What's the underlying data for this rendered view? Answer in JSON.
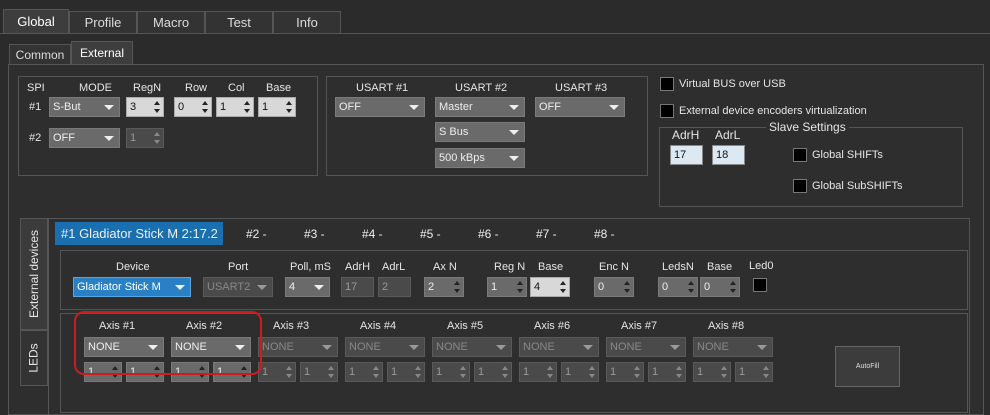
{
  "top_tabs": [
    "Global",
    "Profile",
    "Macro",
    "Test",
    "Info"
  ],
  "sub_tabs": [
    "Common",
    "External"
  ],
  "spi": {
    "headers": [
      "SPI",
      "MODE",
      "RegN",
      "Row",
      "Col",
      "Base"
    ],
    "row_labels": [
      "#1",
      "#2"
    ],
    "row1": {
      "mode": "S-But",
      "regn": "3",
      "row": "0",
      "col": "1",
      "base": "1"
    },
    "row2": {
      "mode": "OFF",
      "regn": "1"
    }
  },
  "usart": {
    "headers": [
      "USART #1",
      "USART #2",
      "USART #3"
    ],
    "u1": "OFF",
    "u2_mode": "Master",
    "u2_bus": "S Bus",
    "u2_speed": "500 kBps",
    "u3": "OFF"
  },
  "options": {
    "virtual_bus": "Virtual BUS over USB",
    "ext_encoders": "External device encoders virtualization"
  },
  "slave": {
    "title": "Slave Settings",
    "adrh_label": "AdrH",
    "adrl_label": "AdrL",
    "adrh": "17",
    "adrl": "18",
    "global_shifts": "Global SHIFTs",
    "global_subshifts": "Global SubSHIFTs"
  },
  "side_tabs": [
    "External devices",
    "LEDs"
  ],
  "device_tabs": [
    "#1 Gladiator Stick M 2:17.2",
    "#2 -",
    "#3 -",
    "#4 -",
    "#5 -",
    "#6 -",
    "#7 -",
    "#8 -"
  ],
  "device": {
    "headers": [
      "Device",
      "Port",
      "Poll, mS",
      "AdrH",
      "AdrL",
      "Ax N",
      "Reg N",
      "Base",
      "Enc N",
      "LedsN",
      "Base",
      "Led0"
    ],
    "device": "Gladiator Stick M",
    "port": "USART2",
    "poll": "4",
    "adrh": "17",
    "adrl": "2",
    "axn": "2",
    "regn": "1",
    "base": "4",
    "encn": "0",
    "ledsn": "0",
    "led_base": "0"
  },
  "axes": {
    "labels": [
      "Axis #1",
      "Axis #2",
      "Axis #3",
      "Axis #4",
      "Axis #5",
      "Axis #6",
      "Axis #7",
      "Axis #8"
    ],
    "value": "NONE",
    "spin_value": "1",
    "autofill": "AutoFill"
  },
  "colors": {
    "highlight": "#cc1d1d",
    "active_tab": "#1a6fb0",
    "combo_blue": "#2a80c4"
  }
}
